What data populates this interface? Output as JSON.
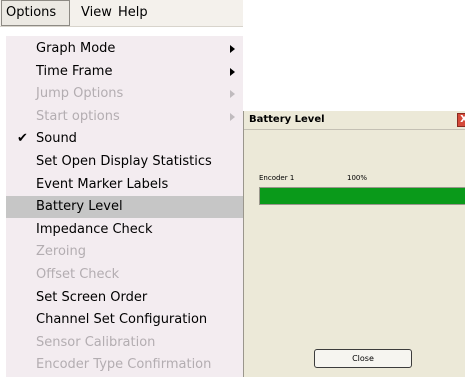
{
  "menubar": {
    "items": [
      {
        "label": "Options",
        "active": true
      },
      {
        "label": "View"
      },
      {
        "label": "Help"
      }
    ]
  },
  "options_menu": {
    "items": [
      {
        "label": "Graph Mode",
        "enabled": true,
        "submenu": true
      },
      {
        "label": "Time Frame",
        "enabled": true,
        "submenu": true
      },
      {
        "label": "Jump Options",
        "enabled": false,
        "submenu": true
      },
      {
        "label": "Start options",
        "enabled": false,
        "submenu": true
      },
      {
        "label": "Sound",
        "enabled": true,
        "checked": true
      },
      {
        "label": "Set Open Display Statistics",
        "enabled": true
      },
      {
        "label": "Event Marker Labels",
        "enabled": true
      },
      {
        "label": "Battery Level",
        "enabled": true,
        "highlighted": true
      },
      {
        "label": "Impedance Check",
        "enabled": true
      },
      {
        "label": "Zeroing",
        "enabled": false
      },
      {
        "label": "Offset Check",
        "enabled": false
      },
      {
        "label": "Set Screen Order",
        "enabled": true
      },
      {
        "label": "Channel Set Configuration",
        "enabled": true
      },
      {
        "label": "Sensor Calibration",
        "enabled": false
      },
      {
        "label": "Encoder Type Confirmation",
        "enabled": false
      }
    ],
    "check_glyph": "✔"
  },
  "battery_dialog": {
    "title": "Battery Level",
    "close_icon": "X",
    "encoder_label": "Encoder 1",
    "percent_label": "100%",
    "level": 1.0,
    "bar_color": "#0a9a1a",
    "close_button_label": "Close"
  }
}
